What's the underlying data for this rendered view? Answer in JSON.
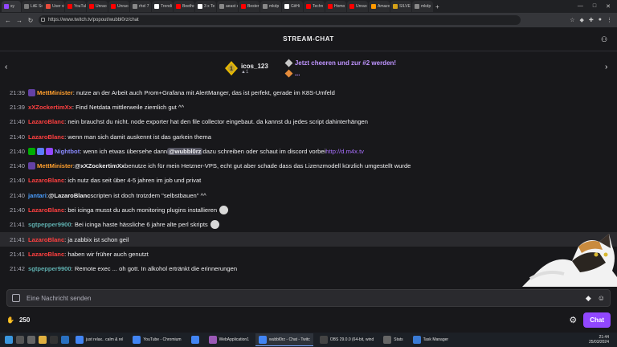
{
  "browser": {
    "tabs": [
      {
        "label": "sy",
        "color": "#9147ff",
        "active": true
      },
      {
        "label": "LitE Sc",
        "color": "#7c7c7c"
      },
      {
        "label": "User vi",
        "color": "#e74c3c"
      },
      {
        "label": "YouTub",
        "color": "#ff0000"
      },
      {
        "label": "Unrao",
        "color": "#ff0000"
      },
      {
        "label": "Unrao",
        "color": "#ff0000"
      },
      {
        "label": "rhel 7",
        "color": "#888888"
      },
      {
        "label": "Trendi",
        "color": "#ffffff"
      },
      {
        "label": "Beetho",
        "color": "#ff0000"
      },
      {
        "label": "3 x Te",
        "color": "#ffffff"
      },
      {
        "label": "aeast s",
        "color": "#888888"
      },
      {
        "label": "Bester",
        "color": "#ff0000"
      },
      {
        "label": "mkdp",
        "color": "#888888"
      },
      {
        "label": "GitHi",
        "color": "#ffffff"
      },
      {
        "label": "Techn",
        "color": "#ff0000"
      },
      {
        "label": "Homo",
        "color": "#ff0000"
      },
      {
        "label": "Unrao",
        "color": "#ff0000"
      },
      {
        "label": "Amazo",
        "color": "#ff9900"
      },
      {
        "label": "SILVE",
        "color": "#d4a017"
      },
      {
        "label": "mkdp",
        "color": "#888888"
      }
    ],
    "url": "https://www.twitch.tv/popout/wubbl0rz/chat"
  },
  "chat": {
    "title": "STREAM-CHAT",
    "hype": {
      "leader_name": "icos_123",
      "leader_count": "1",
      "cheer_text": "Jetzt cheeren und zur #2 werden!",
      "cheer_more": "..."
    },
    "messages": [
      {
        "time": "21:39",
        "badges": [
          "#6441a5"
        ],
        "user": "MettMinister",
        "color": "#ff9f2e",
        "parts": [
          {
            "t": "text",
            "v": ": nutze an der Arbeit auch Prom+Grafana mit AlertManger, das ist perfekt, gerade im K8S-Umfeld"
          }
        ]
      },
      {
        "time": "21:39",
        "badges": [],
        "user": "xXZockertimXx",
        "color": "#ff4040",
        "parts": [
          {
            "t": "text",
            "v": ": Find Netdata mittlerweile ziemlich gut ^^"
          }
        ]
      },
      {
        "time": "21:40",
        "badges": [],
        "user": "LazaroBlanc",
        "color": "#ff4040",
        "parts": [
          {
            "t": "text",
            "v": ": nein brauchst du nicht. node exporter hat den file collector eingebaut. da kannst du jedes script dahinterhängen"
          }
        ]
      },
      {
        "time": "21:40",
        "badges": [],
        "user": "LazaroBlanc",
        "color": "#ff4040",
        "parts": [
          {
            "t": "text",
            "v": ": wenn man sich damit auskennt ist das garkein thema"
          }
        ]
      },
      {
        "time": "21:40",
        "badges": [
          "#00ad03",
          "#5c7cfa",
          "#9147ff"
        ],
        "user": "Nightbot",
        "color": "#8a8aff",
        "parts": [
          {
            "t": "text",
            "v": ": wenn ich etwas übersehe dann "
          },
          {
            "t": "mention-box",
            "v": "@wubbl0rz"
          },
          {
            "t": "text",
            "v": " dazu schreiben oder schaut im discord vorbei "
          },
          {
            "t": "link",
            "v": "http://d.m4x.tv"
          }
        ]
      },
      {
        "time": "21:40",
        "badges": [
          "#6441a5"
        ],
        "user": "MettMinister",
        "color": "#ff9f2e",
        "parts": [
          {
            "t": "text",
            "v": ": "
          },
          {
            "t": "mention",
            "v": "@xXZockertimXx"
          },
          {
            "t": "text",
            "v": " benutze ich für mein Hetzner-VPS, echt gut aber schade dass das Lizenzmodell kürzlich umgestellt wurde"
          }
        ]
      },
      {
        "time": "21:40",
        "badges": [],
        "user": "LazaroBlanc",
        "color": "#ff4040",
        "parts": [
          {
            "t": "text",
            "v": ": ich nutz das seit über 4-5 jahren im job und privat"
          }
        ]
      },
      {
        "time": "21:40",
        "badges": [],
        "user": "jantari",
        "color": "#4a9eff",
        "parts": [
          {
            "t": "text",
            "v": ": "
          },
          {
            "t": "mention",
            "v": "@LazaroBlanc"
          },
          {
            "t": "text",
            "v": " scripten ist doch trotzdem \"selbstbauen\" ^^"
          }
        ]
      },
      {
        "time": "21:40",
        "badges": [],
        "user": "LazaroBlanc",
        "color": "#ff4040",
        "parts": [
          {
            "t": "text",
            "v": ": bei icinga musst du auch monitoring plugins installieren"
          },
          {
            "t": "emote",
            "v": "emote-face"
          }
        ]
      },
      {
        "time": "21:41",
        "badges": [],
        "user": "sgtpepper9900",
        "color": "#5fb0b0",
        "parts": [
          {
            "t": "text",
            "v": ": Bei icinga haste hässliche 6 jahre alte perl skripts"
          },
          {
            "t": "emote",
            "v": "emote-pepe"
          }
        ]
      },
      {
        "time": "21:41",
        "badges": [],
        "user": "LazaroBlanc",
        "color": "#ff4040",
        "parts": [
          {
            "t": "text",
            "v": ": ja zabbix ist schon geil"
          }
        ],
        "highlight": true
      },
      {
        "time": "21:41",
        "badges": [],
        "user": "LazaroBlanc",
        "color": "#ff4040",
        "parts": [
          {
            "t": "text",
            "v": ": haben wir früher auch genutzt"
          }
        ]
      },
      {
        "time": "21:42",
        "badges": [],
        "user": "sgtpepper9900",
        "color": "#5fb0b0",
        "parts": [
          {
            "t": "text",
            "v": ": Remote exec ... oh gott. In alkohol ertränkt die erinnerungen"
          }
        ]
      }
    ],
    "input_placeholder": "Eine Nachricht senden",
    "points": "250",
    "send_label": "Chat"
  },
  "taskbar": {
    "apps": [
      {
        "label": "just relax.. calm & rel",
        "color": "#4285f4"
      },
      {
        "label": "YouTube - Chromium",
        "color": "#4285f4"
      },
      {
        "label": "",
        "color": "#4285f4"
      },
      {
        "label": "WebApplication1",
        "color": "#9b59b6"
      },
      {
        "label": "wubbl0rz - Chat - Twitc",
        "color": "#4285f4",
        "active": true
      },
      {
        "label": "OBS 29.0.0 (64-bit, wind",
        "color": "#444444"
      },
      {
        "label": "Stats",
        "color": "#666666"
      },
      {
        "label": "Task Manager",
        "color": "#3a7bd5"
      }
    ],
    "time": "21:44",
    "date": "25/03/2024"
  }
}
